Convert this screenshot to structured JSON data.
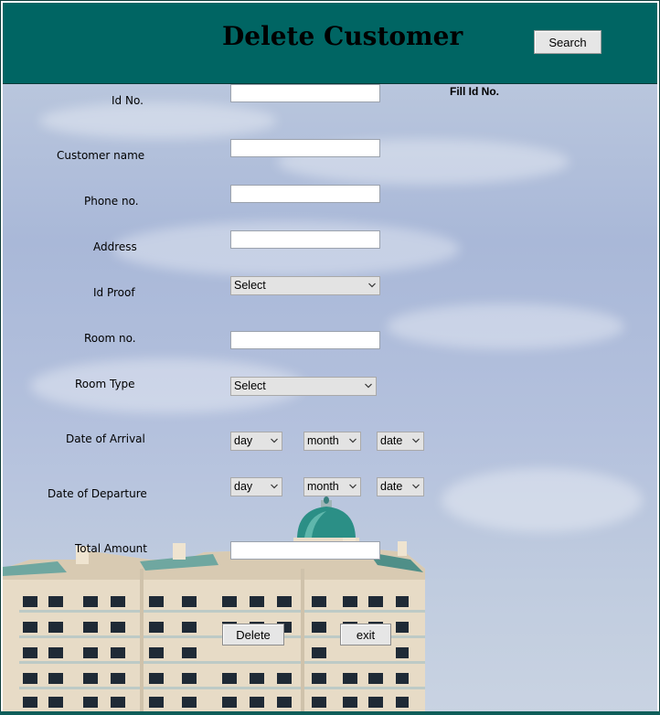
{
  "header": {
    "title": "Delete Customer",
    "search_label": "Search",
    "color": "#006563"
  },
  "hint": "Fill Id No.",
  "form": {
    "id_no_label": "Id No.",
    "id_no_value": "",
    "customer_name_label": "Customer name",
    "customer_name_value": "",
    "phone_label": "Phone no.",
    "phone_value": "",
    "address_label": "Address",
    "address_value": "",
    "id_proof_label": "Id Proof",
    "id_proof_selected": "Select",
    "room_no_label": "Room no.",
    "room_no_value": "",
    "room_type_label": "Room Type",
    "room_type_selected": "Select",
    "arrival_label": "Date of Arrival",
    "arrival_day": "day",
    "arrival_month": "month",
    "arrival_date": "date",
    "departure_label": "Date of Departure",
    "departure_day": "day",
    "departure_month": "month",
    "departure_date": "date",
    "total_label": "Total Amount",
    "total_value": ""
  },
  "actions": {
    "delete_label": "Delete",
    "exit_label": "exit"
  }
}
